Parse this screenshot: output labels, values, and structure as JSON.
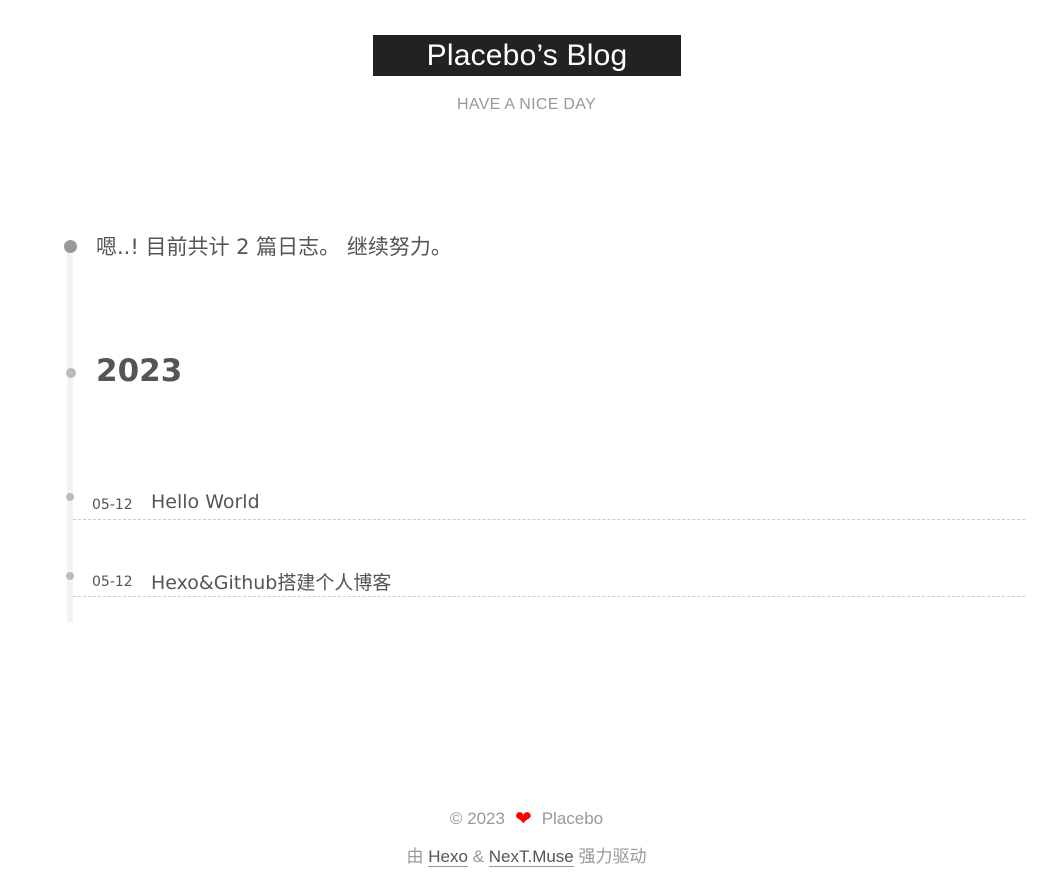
{
  "header": {
    "brand": "Placebo’s Blog",
    "subtitle": "HAVE A NICE DAY"
  },
  "archive": {
    "intro": "嗯..! 目前共计 2 篇日志。 继续努力。",
    "year": "2023",
    "posts": [
      {
        "date": "05-12",
        "title": "Hello World"
      },
      {
        "date": "05-12",
        "title": "Hexo&Github搭建个人博客"
      }
    ]
  },
  "footer": {
    "copyright_prefix": "© 2023",
    "heart_icon": "heart-icon",
    "heart_color": "#ff0000",
    "author": "Placebo",
    "powered_prefix": "由",
    "hexo_link": "Hexo",
    "amp": "&",
    "theme_link": "NexT.Muse",
    "powered_suffix": "强力驱动"
  }
}
